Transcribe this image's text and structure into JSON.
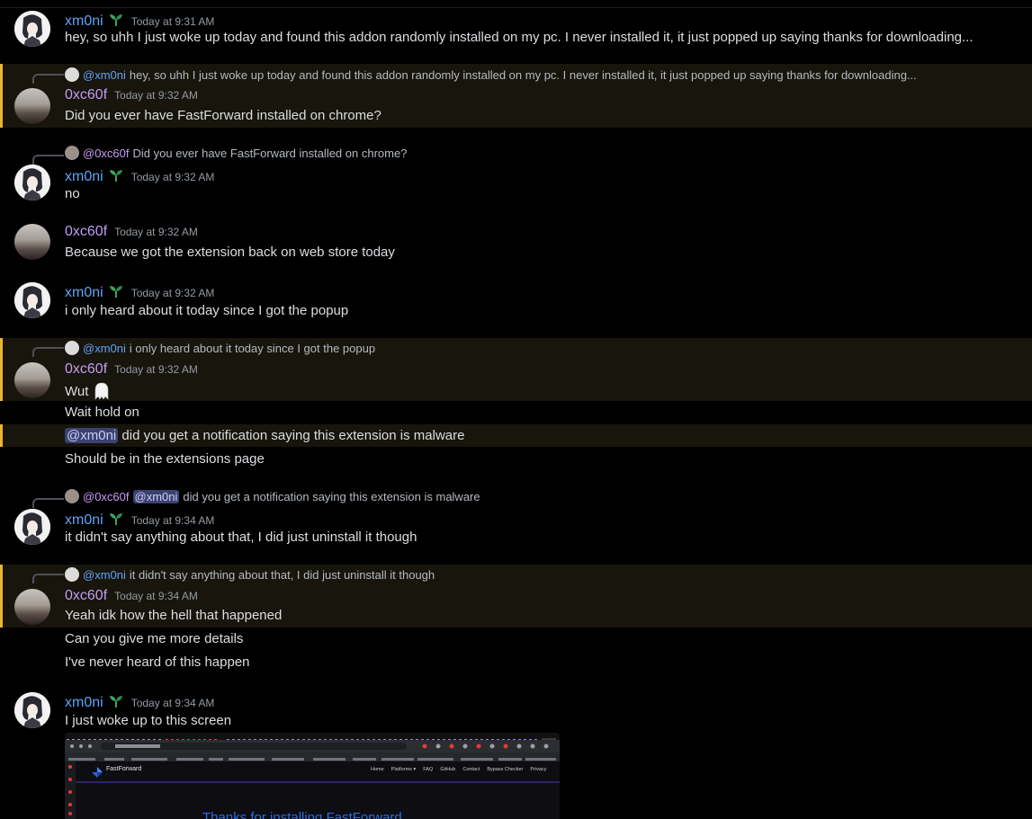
{
  "users": {
    "xm": {
      "name": "xm0ni"
    },
    "ox": {
      "name": "0xc60f"
    }
  },
  "colors": {
    "xm_name": "#5fa4f5",
    "ox_name": "#c49cf5",
    "highlight_bar": "#f0b232",
    "background": "#000000"
  },
  "messages": [
    {
      "author": "xm0ni",
      "time": "Today at 9:31 AM",
      "text": "hey, so uhh I just woke up today and found this addon randomly installed on my pc. I never installed it, it just popped up saying thanks for downloading..."
    },
    {
      "author": "0xc60f",
      "time": "Today at 9:32 AM",
      "reply_to": "@xm0ni",
      "reply_text": "hey, so uhh I just woke up today and found this addon randomly installed on my pc. I never installed it, it just popped up saying thanks for downloading...",
      "text": "Did you ever have FastForward installed on chrome?"
    },
    {
      "author": "xm0ni",
      "time": "Today at 9:32 AM",
      "reply_to": "@0xc60f",
      "reply_text": "Did you ever have FastForward installed on chrome?",
      "text": "no"
    },
    {
      "author": "0xc60f",
      "time": "Today at 9:32 AM",
      "text": "Because we got the extension back on web store today"
    },
    {
      "author": "xm0ni",
      "time": "Today at 9:32 AM",
      "text": "i only heard about it today since I got the popup"
    },
    {
      "author": "0xc60f",
      "time": "Today at 9:32 AM",
      "reply_to": "@xm0ni",
      "reply_text": "i only heard about it today since I got the popup",
      "text": "Wut",
      "followups": [
        "Wait hold on",
        "did you get a notification saying this extension is malware",
        "Should be in the extensions page"
      ],
      "mention": "@xm0ni"
    },
    {
      "author": "xm0ni",
      "time": "Today at 9:34 AM",
      "reply_to": "@0xc60f",
      "reply_mention": "@xm0ni",
      "reply_text": "did you get a notification saying this extension is malware",
      "text": "it didn't say anything about that, I did just uninstall it though"
    },
    {
      "author": "0xc60f",
      "time": "Today at 9:34 AM",
      "reply_to": "@xm0ni",
      "reply_text": "it didn't say anything about that, I did just uninstall it though",
      "text": "Yeah idk how the hell that happened",
      "followups": [
        "Can you give me more details",
        "I've never heard of this happen"
      ]
    },
    {
      "author": "xm0ni",
      "time": "Today at 9:34 AM",
      "text": "I just woke up to this screen"
    }
  ],
  "screenshot": {
    "brand": "FastForward",
    "nav": [
      "Home",
      "Platforms ▾",
      "FAQ",
      "GitHub",
      "Contact",
      "Bypass Checker",
      "Privacy"
    ],
    "headline": "Thanks for installing FastForward"
  }
}
